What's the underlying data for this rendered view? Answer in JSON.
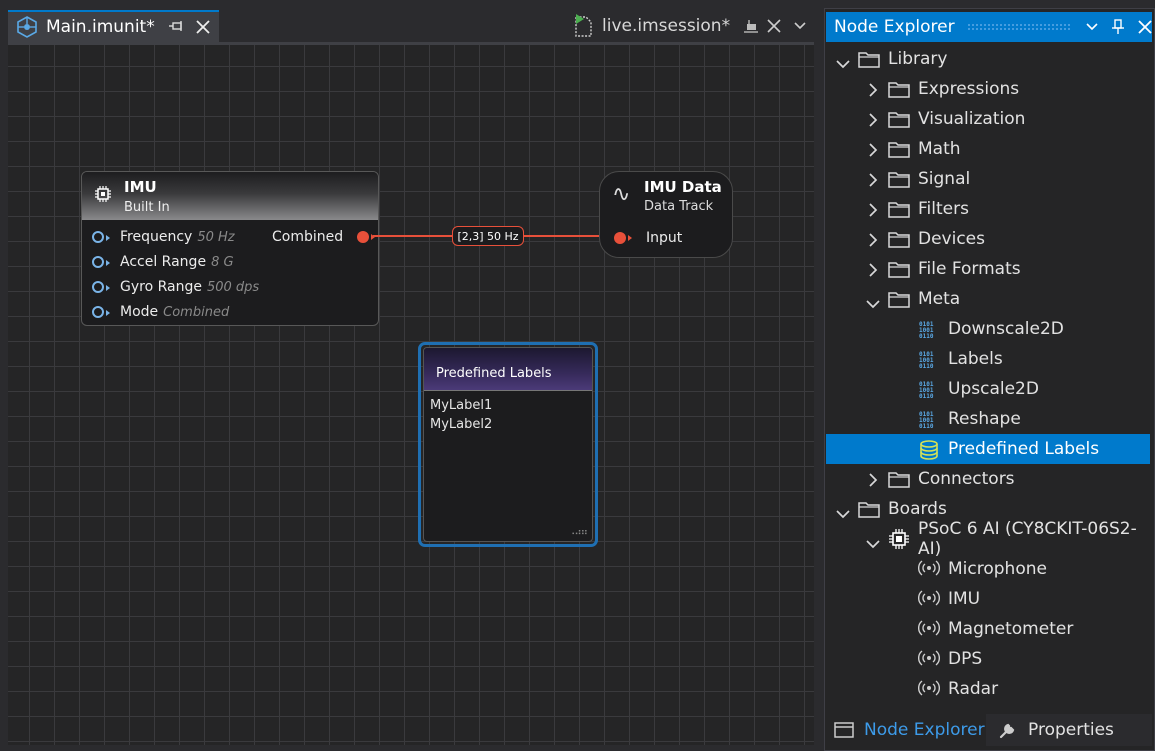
{
  "tabs": {
    "main": {
      "title": "Main.imunit*"
    },
    "live": {
      "title": "live.imsession*"
    }
  },
  "graph": {
    "imu_node": {
      "title": "IMU",
      "subtitle": "Built In",
      "inputs": [
        {
          "label": "Frequency",
          "value": "50 Hz"
        },
        {
          "label": "Accel Range",
          "value": "8 G"
        },
        {
          "label": "Gyro Range",
          "value": "500 dps"
        },
        {
          "label": "Mode",
          "value": "Combined"
        }
      ],
      "output": "Combined"
    },
    "link_badge": "[2,3] 50 Hz",
    "track_node": {
      "title": "IMU Data",
      "subtitle": "Data Track",
      "input": "Input"
    },
    "labels_node": {
      "title": "Predefined Labels",
      "items": [
        "MyLabel1",
        "MyLabel2"
      ]
    }
  },
  "explorer": {
    "title": "Node Explorer",
    "tree": [
      {
        "label": "Library",
        "icon": "folder",
        "expanded": true
      },
      {
        "label": "Expressions",
        "icon": "folder"
      },
      {
        "label": "Visualization",
        "icon": "folder"
      },
      {
        "label": "Math",
        "icon": "folder"
      },
      {
        "label": "Signal",
        "icon": "folder"
      },
      {
        "label": "Filters",
        "icon": "folder"
      },
      {
        "label": "Devices",
        "icon": "folder"
      },
      {
        "label": "File Formats",
        "icon": "folder"
      },
      {
        "label": "Meta",
        "icon": "folder",
        "expanded": true
      },
      {
        "label": "Downscale2D",
        "icon": "binary"
      },
      {
        "label": "Labels",
        "icon": "binary"
      },
      {
        "label": "Upscale2D",
        "icon": "binary"
      },
      {
        "label": "Reshape",
        "icon": "binary"
      },
      {
        "label": "Predefined Labels",
        "icon": "database",
        "selected": true
      },
      {
        "label": "Connectors",
        "icon": "folder"
      },
      {
        "label": "Boards",
        "icon": "folder",
        "expanded": true
      },
      {
        "label": "PSoC 6 AI (CY8CKIT-06S2-AI)",
        "icon": "chip",
        "expanded": true
      },
      {
        "label": "Microphone",
        "icon": "sensor"
      },
      {
        "label": "IMU",
        "icon": "sensor"
      },
      {
        "label": "Magnetometer",
        "icon": "sensor"
      },
      {
        "label": "DPS",
        "icon": "sensor"
      },
      {
        "label": "Radar",
        "icon": "sensor"
      }
    ],
    "bottom_tabs": {
      "node_explorer": "Node Explorer",
      "properties": "Properties"
    }
  },
  "colors": {
    "accent": "#007acc",
    "link": "#e8503a",
    "port_in": "#7ab4e8",
    "selection_outline": "#1f6fb2"
  }
}
